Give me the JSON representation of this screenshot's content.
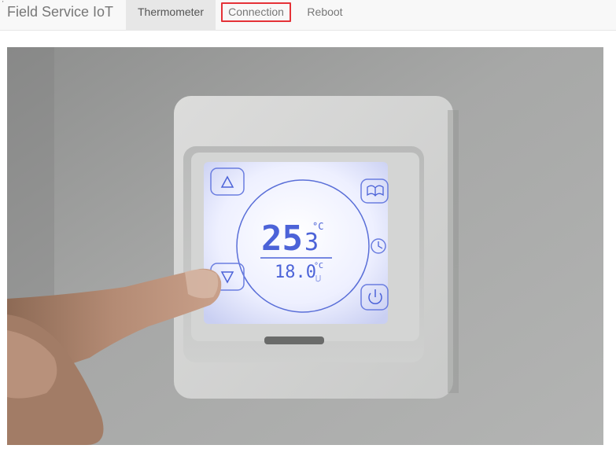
{
  "brand": "Field Service IoT",
  "nav": {
    "items": [
      {
        "label": "Thermometer",
        "active": true
      },
      {
        "label": "Connection",
        "active": false,
        "highlighted": true
      },
      {
        "label": "Reboot",
        "active": false
      }
    ]
  },
  "thermostat": {
    "current_temp_main": "25",
    "current_temp_decimal": "3",
    "current_unit": "°C",
    "set_temp": "18.0",
    "set_unit": "°C"
  },
  "colors": {
    "navbar_bg": "#f8f8f8",
    "active_tab_bg": "#e7e7e7",
    "highlight_border": "#e53238",
    "lcd_text": "#4c63d8",
    "lcd_screen": "#eef0ff"
  }
}
